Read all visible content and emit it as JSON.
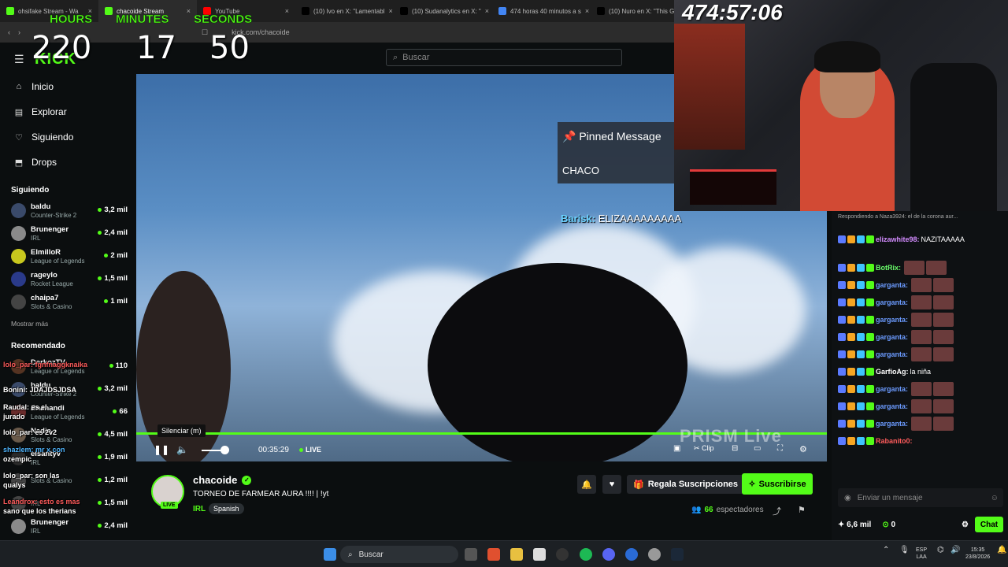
{
  "browser": {
    "tabs": [
      {
        "label": "ohsifake Stream - Wa"
      },
      {
        "label": "chacoide Stream"
      },
      {
        "label": "YouTube"
      },
      {
        "label": "(10) Ivo en X: \"Lamentabl"
      },
      {
        "label": "(10) Sudanalytics en X: \""
      },
      {
        "label": "474 horas 40 minutos a s"
      },
      {
        "label": "(10) Nuro en X: \"This GT"
      }
    ],
    "url": "kick.com/chacoide"
  },
  "timer": {
    "hours_label": "HOURS",
    "minutes_label": "MINUTES",
    "seconds_label": "SECONDS",
    "hours": "220",
    "minutes": "17",
    "seconds": "50"
  },
  "cam_timer": "474:57:06",
  "header": {
    "search_placeholder": "Buscar",
    "logo": "KICK"
  },
  "sidebar": {
    "nav": [
      {
        "label": "Inicio",
        "icon": "home-icon"
      },
      {
        "label": "Explorar",
        "icon": "browse-icon"
      },
      {
        "label": "Siguiendo",
        "icon": "heart-icon"
      },
      {
        "label": "Drops",
        "icon": "drops-icon"
      }
    ],
    "following_title": "Siguiendo",
    "following": [
      {
        "name": "baldu",
        "category": "Counter-Strike 2",
        "viewers": "3,2 mil",
        "color": "#3a4a6a"
      },
      {
        "name": "Brunenger",
        "category": "IRL",
        "viewers": "2,4 mil",
        "color": "#8a8a8a"
      },
      {
        "name": "ElmilloR",
        "category": "League of Legends",
        "viewers": "2 mil",
        "color": "#c8c81e"
      },
      {
        "name": "rageylo",
        "category": "Rocket League",
        "viewers": "1,5 mil",
        "color": "#2a3a8a"
      },
      {
        "name": "chaipa7",
        "category": "Slots & Casino",
        "viewers": "1 mil",
        "color": "#444"
      }
    ],
    "show_more": "Mostrar más",
    "recommended_title": "Recomendado",
    "recommended": [
      {
        "name": "DarkozTV",
        "category": "League of Legends",
        "viewers": "110",
        "color": "#553322"
      },
      {
        "name": "baldu",
        "category": "Counter-Strike 2",
        "viewers": "3,2 mil",
        "color": "#3a4a6a"
      },
      {
        "name": "Enanandi",
        "category": "League of Legends",
        "viewers": "66",
        "color": "#6a2a2a"
      },
      {
        "name": "Nadia",
        "category": "Slots & Casino",
        "viewers": "4,5 mil",
        "color": "#6a5a4a"
      },
      {
        "name": "eisantyv",
        "category": "IRL",
        "viewers": "1,9 mil",
        "color": "#2a2a2a"
      },
      {
        "name": "",
        "category": "Slots & Casino",
        "viewers": "1,2 mil",
        "color": "#444"
      },
      {
        "name": "",
        "category": "IRL",
        "viewers": "1,5 mil",
        "color": "#444"
      },
      {
        "name": "Brunenger",
        "category": "IRL",
        "viewers": "2,4 mil",
        "color": "#8a8a8a"
      }
    ],
    "overlay_chat": [
      {
        "text": "lolo_par: fgnfnaggknaika",
        "color": "#ff5c5c"
      },
      {
        "text": "Bonini: JDAJDSJDSA",
        "color": "#ffffff"
      },
      {
        "text": "Raudal: es el",
        "color": "#ffffff"
      },
      {
        "text": "jurado",
        "color": "#ffffff"
      },
      {
        "text": "lolo_par: es 2v2",
        "color": "#ffffff"
      },
      {
        "text": "shazlem: mr x con",
        "color": "#4fb6ff"
      },
      {
        "text": "ozempic",
        "color": "#ffffff"
      },
      {
        "text": "lolo_par: son las",
        "color": "#ffffff"
      },
      {
        "text": "qualys",
        "color": "#ffffff"
      },
      {
        "text": "Leandrox: esto es mas",
        "color": "#ff5c5c"
      },
      {
        "text": "sano que los therians",
        "color": "#ffffff"
      }
    ]
  },
  "player": {
    "tooltip": "Silenciar (m)",
    "time": "00:35:29",
    "live": "LIVE",
    "clip": "Clip",
    "watermark": "PRISM Live",
    "pinned_title": "Pinned Message",
    "pinned_body": "CHACO",
    "overlay_user": "Barisk:",
    "overlay_text": "ELIZAAAAAAAAA"
  },
  "stream": {
    "channel": "chacoide",
    "title": "TORNEO DE FARMEAR AURA !!!! | !yt",
    "category": "IRL",
    "language": "Spanish",
    "live_badge": "LIVE",
    "gift_label": "Regala Suscripciones",
    "subscribe_label": "Suscribirse",
    "viewers": "66",
    "viewers_label": "espectadores"
  },
  "chat": {
    "reply_text": "Respondiendo a Naza3924: el de la corona aur...",
    "messages": [
      {
        "user": "elizawhite98:",
        "text": "NAZITAAAAA",
        "color": "#d38cff"
      },
      {
        "user": "BotRix:",
        "text": "",
        "color": "#6bff6b"
      },
      {
        "user": "garganta:",
        "text": "",
        "color": "#6b9bff"
      },
      {
        "user": "garganta:",
        "text": "",
        "color": "#6b9bff"
      },
      {
        "user": "garganta:",
        "text": "",
        "color": "#6b9bff"
      },
      {
        "user": "garganta:",
        "text": "",
        "color": "#6b9bff"
      },
      {
        "user": "garganta:",
        "text": "",
        "color": "#6b9bff"
      },
      {
        "user": "GarfioAg:",
        "text": "la niña",
        "color": "#ffffff"
      },
      {
        "user": "garganta:",
        "text": "",
        "color": "#6b9bff"
      },
      {
        "user": "garganta:",
        "text": "",
        "color": "#6b9bff"
      },
      {
        "user": "garganta:",
        "text": "",
        "color": "#6b9bff"
      },
      {
        "user": "Rabanito0:",
        "text": "",
        "color": "#ff5c5c"
      }
    ],
    "input_placeholder": "Enviar un mensaje",
    "points": "6,6 mil",
    "kicks": "0",
    "chat_button": "Chat"
  },
  "taskbar": {
    "search": "Buscar",
    "lang_top": "ESP",
    "lang_bottom": "LAA",
    "time": "15:35",
    "date": "23/8/2026"
  },
  "colors": {
    "accent": "#53fc18",
    "bg": "#0b0e0f"
  }
}
